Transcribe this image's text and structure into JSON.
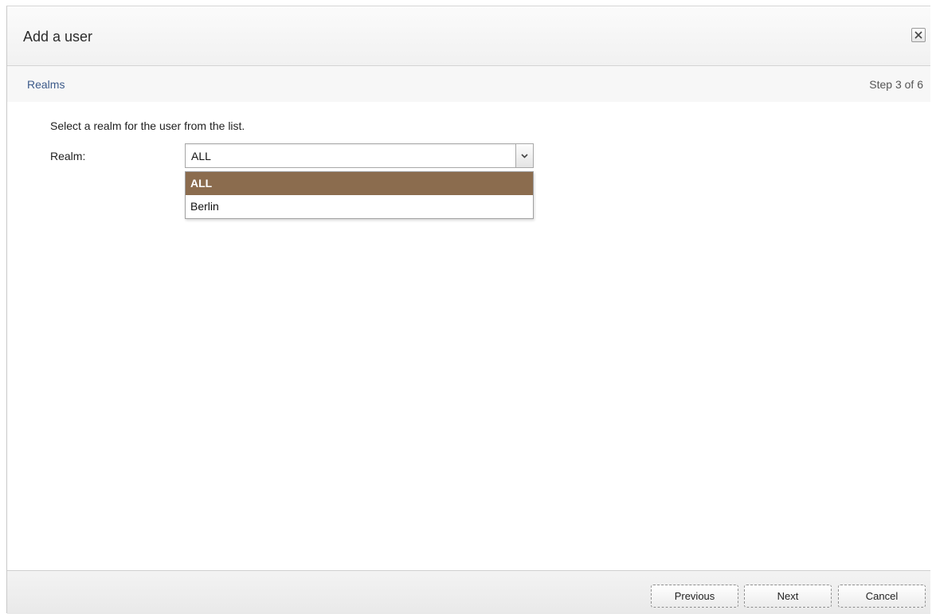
{
  "dialog": {
    "title": "Add a user",
    "close_icon": "close-icon"
  },
  "step": {
    "name": "Realms",
    "progress": "Step 3 of 6"
  },
  "form": {
    "instruction": "Select a realm for the user from the list.",
    "realm_label": "Realm:",
    "realm_value": "ALL",
    "realm_options": [
      "ALL",
      "Berlin"
    ],
    "selected_option": "ALL",
    "arrow_icon": "chevron-down-icon"
  },
  "footer": {
    "previous_label": "Previous",
    "next_label": "Next",
    "cancel_label": "Cancel"
  },
  "colors": {
    "selected_option_bg": "#8b6c4e",
    "link_blue": "#3c5a8a"
  }
}
